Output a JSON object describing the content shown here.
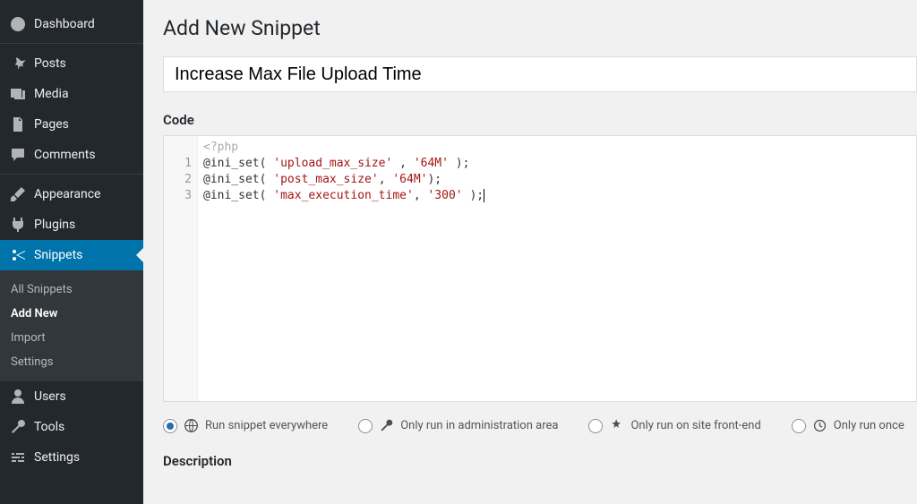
{
  "sidebar": {
    "items": [
      {
        "label": "Dashboard"
      },
      {
        "label": "Posts"
      },
      {
        "label": "Media"
      },
      {
        "label": "Pages"
      },
      {
        "label": "Comments"
      },
      {
        "label": "Appearance"
      },
      {
        "label": "Plugins"
      },
      {
        "label": "Snippets"
      },
      {
        "label": "Users"
      },
      {
        "label": "Tools"
      },
      {
        "label": "Settings"
      }
    ],
    "sub": [
      {
        "label": "All Snippets"
      },
      {
        "label": "Add New"
      },
      {
        "label": "Import"
      },
      {
        "label": "Settings"
      }
    ]
  },
  "page": {
    "title": "Add New Snippet",
    "snippet_name": "Increase Max File Upload Time",
    "code_label": "Code",
    "description_label": "Description"
  },
  "editor": {
    "placeholder": "<?php",
    "lines": {
      "n1": "1",
      "n2": "2",
      "n3": "3",
      "l1a": "@ini_set( ",
      "l1b": "'upload_max_size'",
      "l1c": " , ",
      "l1d": "'64M'",
      "l1e": " );",
      "l2a": "@ini_set( ",
      "l2b": "'post_max_size'",
      "l2c": ", ",
      "l2d": "'64M'",
      "l2e": ");",
      "l3a": "@ini_set( ",
      "l3b": "'max_execution_time'",
      "l3c": ", ",
      "l3d": "'300'",
      "l3e": " );"
    }
  },
  "scope": {
    "everywhere": "Run snippet everywhere",
    "admin": "Only run in administration area",
    "frontend": "Only run on site front-end",
    "once": "Only run once"
  }
}
